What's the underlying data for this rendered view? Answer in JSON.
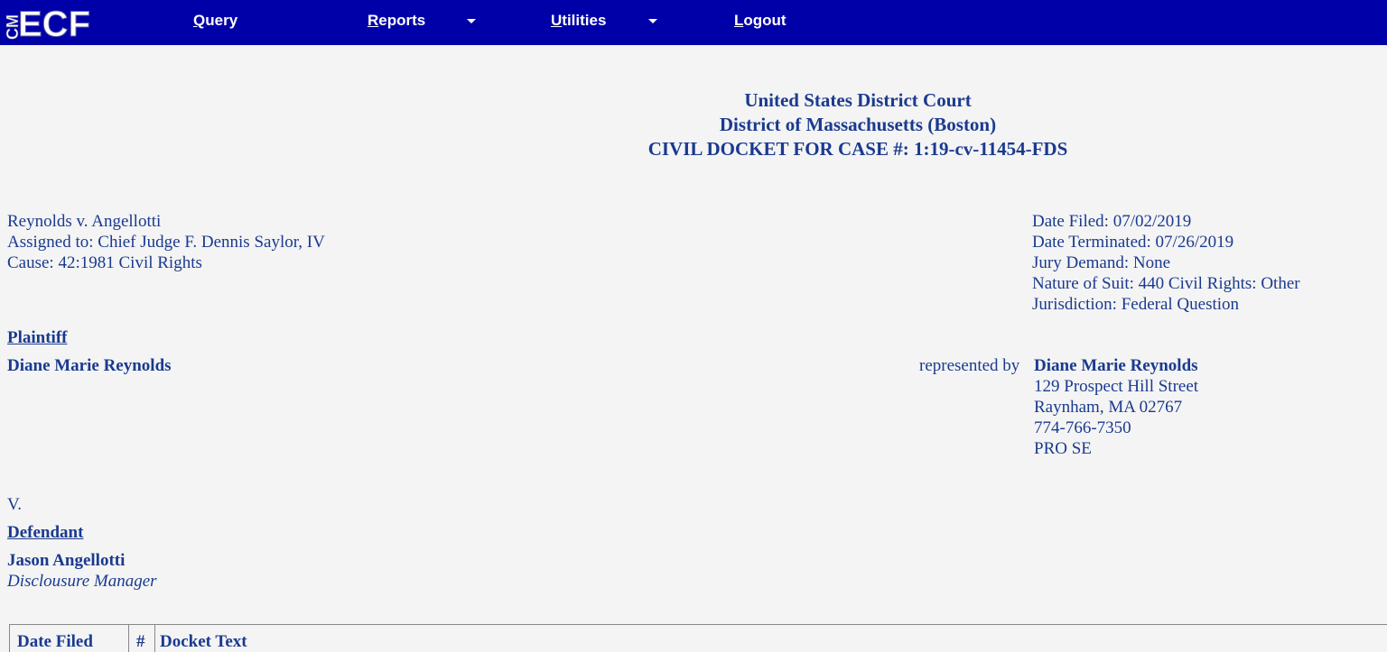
{
  "app": {
    "logo_text": "ECF",
    "logo_prefix": "CM"
  },
  "nav": {
    "query": "Query",
    "reports": "Reports",
    "utilities": "Utilities",
    "logout": "Logout"
  },
  "header": {
    "court": "United States District Court",
    "district": "District of Massachusetts (Boston)",
    "case_title": "CIVIL DOCKET FOR CASE #: 1:19-cv-11454-FDS"
  },
  "case": {
    "caption": "Reynolds v. Angellotti",
    "assigned": "Assigned to: Chief Judge F. Dennis Saylor, IV",
    "cause": "Cause: 42:1981 Civil Rights",
    "date_filed": "Date Filed: 07/02/2019",
    "date_terminated": "Date Terminated: 07/26/2019",
    "jury_demand": "Jury Demand: None",
    "nature_of_suit": "Nature of Suit: 440 Civil Rights: Other",
    "jurisdiction": "Jurisdiction: Federal Question"
  },
  "plaintiff": {
    "heading": "Plaintiff",
    "name": "Diane Marie Reynolds",
    "represented_by": "represented by",
    "rep_name": "Diane Marie Reynolds",
    "rep_street": "129 Prospect Hill Street",
    "rep_city": "Raynham, MA 02767",
    "rep_phone": "774-766-7350",
    "rep_status": "PRO SE"
  },
  "versus": "V.",
  "defendant": {
    "heading": "Defendant",
    "name": "Jason Angellotti",
    "title": "Disclousure Manager"
  },
  "docket_table": {
    "columns": [
      "Date Filed",
      "#",
      "Docket Text"
    ]
  },
  "colors": {
    "nav_bg": "#0000a8",
    "text": "#1a3a8f",
    "page_bg": "#f4f4f4"
  }
}
